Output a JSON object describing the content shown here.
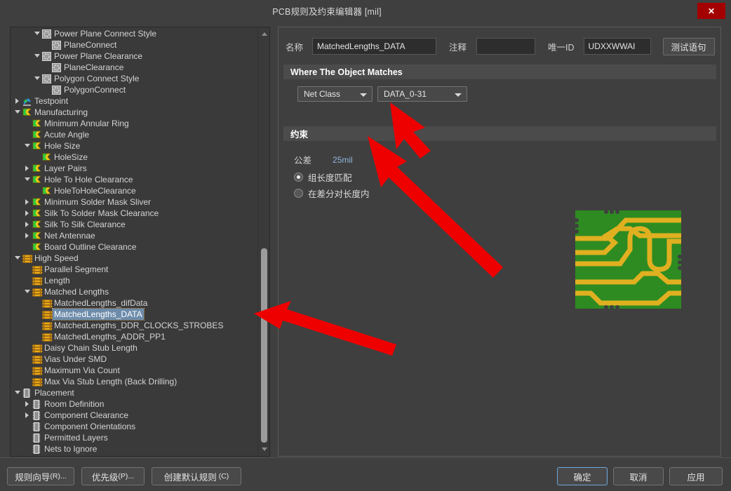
{
  "window": {
    "title": "PCB规则及约束编辑器 [mil]",
    "close_label": "✕"
  },
  "tree": {
    "items": [
      {
        "label": "Power Plane Connect Style",
        "indent": 3,
        "expander": "open",
        "icon": "plane-icon"
      },
      {
        "label": "PlaneConnect",
        "indent": 4,
        "expander": "none",
        "icon": "plane-icon"
      },
      {
        "label": "Power Plane Clearance",
        "indent": 3,
        "expander": "open",
        "icon": "plane-icon"
      },
      {
        "label": "PlaneClearance",
        "indent": 4,
        "expander": "none",
        "icon": "plane-icon"
      },
      {
        "label": "Polygon Connect Style",
        "indent": 3,
        "expander": "open",
        "icon": "plane-icon"
      },
      {
        "label": "PolygonConnect",
        "indent": 4,
        "expander": "none",
        "icon": "plane-icon"
      },
      {
        "label": "Testpoint",
        "indent": 1,
        "expander": "closed",
        "icon": "testpoint-icon"
      },
      {
        "label": "Manufacturing",
        "indent": 1,
        "expander": "open",
        "icon": "manufacturing-icon"
      },
      {
        "label": "Minimum Annular Ring",
        "indent": 2,
        "expander": "none",
        "icon": "manufacturing-icon"
      },
      {
        "label": "Acute Angle",
        "indent": 2,
        "expander": "none",
        "icon": "manufacturing-icon"
      },
      {
        "label": "Hole Size",
        "indent": 2,
        "expander": "open",
        "icon": "manufacturing-icon"
      },
      {
        "label": "HoleSize",
        "indent": 3,
        "expander": "none",
        "icon": "manufacturing-icon"
      },
      {
        "label": "Layer Pairs",
        "indent": 2,
        "expander": "closed",
        "icon": "manufacturing-icon"
      },
      {
        "label": "Hole To Hole Clearance",
        "indent": 2,
        "expander": "open",
        "icon": "manufacturing-icon"
      },
      {
        "label": "HoleToHoleClearance",
        "indent": 3,
        "expander": "none",
        "icon": "manufacturing-icon"
      },
      {
        "label": "Minimum Solder Mask Sliver",
        "indent": 2,
        "expander": "closed",
        "icon": "manufacturing-icon"
      },
      {
        "label": "Silk To Solder Mask Clearance",
        "indent": 2,
        "expander": "closed",
        "icon": "manufacturing-icon"
      },
      {
        "label": "Silk To Silk Clearance",
        "indent": 2,
        "expander": "closed",
        "icon": "manufacturing-icon"
      },
      {
        "label": "Net Antennae",
        "indent": 2,
        "expander": "closed",
        "icon": "manufacturing-icon"
      },
      {
        "label": "Board Outline Clearance",
        "indent": 2,
        "expander": "none",
        "icon": "manufacturing-icon"
      },
      {
        "label": "High Speed",
        "indent": 1,
        "expander": "open",
        "icon": "highspeed-icon"
      },
      {
        "label": "Parallel Segment",
        "indent": 2,
        "expander": "none",
        "icon": "highspeed-icon"
      },
      {
        "label": "Length",
        "indent": 2,
        "expander": "none",
        "icon": "highspeed-icon"
      },
      {
        "label": "Matched Lengths",
        "indent": 2,
        "expander": "open",
        "icon": "highspeed-icon"
      },
      {
        "label": "MatchedLengths_difData",
        "indent": 3,
        "expander": "none",
        "icon": "highspeed-icon"
      },
      {
        "label": "MatchedLengths_DATA",
        "indent": 3,
        "expander": "none",
        "icon": "highspeed-icon",
        "selected": true
      },
      {
        "label": "MatchedLengths_DDR_CLOCKS_STROBES",
        "indent": 3,
        "expander": "none",
        "icon": "highspeed-icon"
      },
      {
        "label": "MatchedLengths_ADDR_PP1",
        "indent": 3,
        "expander": "none",
        "icon": "highspeed-icon"
      },
      {
        "label": "Daisy Chain Stub Length",
        "indent": 2,
        "expander": "none",
        "icon": "highspeed-icon"
      },
      {
        "label": "Vias Under SMD",
        "indent": 2,
        "expander": "none",
        "icon": "highspeed-icon"
      },
      {
        "label": "Maximum Via Count",
        "indent": 2,
        "expander": "none",
        "icon": "highspeed-icon"
      },
      {
        "label": "Max Via Stub Length (Back Drilling)",
        "indent": 2,
        "expander": "none",
        "icon": "highspeed-icon"
      },
      {
        "label": "Placement",
        "indent": 1,
        "expander": "open",
        "icon": "placement-icon"
      },
      {
        "label": "Room Definition",
        "indent": 2,
        "expander": "closed",
        "icon": "placement-icon"
      },
      {
        "label": "Component Clearance",
        "indent": 2,
        "expander": "closed",
        "icon": "placement-icon"
      },
      {
        "label": "Component Orientations",
        "indent": 2,
        "expander": "none",
        "icon": "placement-icon"
      },
      {
        "label": "Permitted Layers",
        "indent": 2,
        "expander": "none",
        "icon": "placement-icon"
      },
      {
        "label": "Nets to Ignore",
        "indent": 2,
        "expander": "none",
        "icon": "placement-icon"
      }
    ]
  },
  "detail": {
    "name_label": "名称",
    "name_value": "MatchedLengths_DATA",
    "comment_label": "注释",
    "comment_value": "",
    "uid_label": "唯一ID",
    "uid_value": "UDXXWWAI",
    "test_button": "测试语句",
    "where_header": "Where The Object Matches",
    "scope_combo": "Net Class",
    "target_combo": "DATA_0-31",
    "constraint_header": "约束",
    "tolerance_label": "公差",
    "tolerance_value": "25mil",
    "radio_group_length": "组长度匹配",
    "radio_within_diffpair": "在差分对长度内",
    "pcb_preview": "pcb-trace-preview"
  },
  "footer": {
    "rule_wizard": "规则向导",
    "rule_wizard_mn": "(R)...",
    "priority": "优先级",
    "priority_mn": "(P)...",
    "create_default": "创建默认规则",
    "create_default_mn": "(C)",
    "ok": "确定",
    "cancel": "取消",
    "apply": "应用"
  },
  "colors": {
    "selection": "#6d8cab",
    "close_button": "#a30000",
    "annotation_arrow": "#ee0000",
    "accent_value": "#8fb4d8",
    "pcb_board": "#2e8b21",
    "pcb_trace": "#e0b020"
  }
}
